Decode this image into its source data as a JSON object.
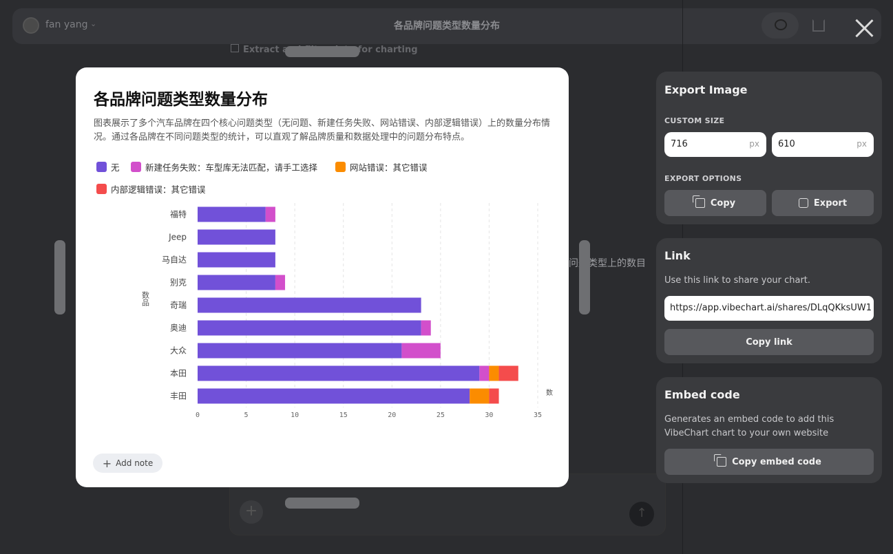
{
  "background": {
    "user_name": "fan yang",
    "chart_title": "各品牌问题类型数量分布",
    "step_label": "Extract and filter data for charting",
    "partial_text": "问题类型上的数目"
  },
  "modal": {
    "title": "各品牌问题类型数量分布",
    "description": "图表展示了多个汽车品牌在四个核心问题类型（无问题、新建任务失败、网站错误、内部逻辑错误）上的数量分布情况。通过各品牌在不同问题类型的统计，可以直观了解品牌质量和数据处理中的问题分布特点。",
    "add_note_label": "Add note"
  },
  "chart_data": {
    "type": "bar",
    "orientation": "horizontal",
    "stacked": true,
    "categories": [
      "福特",
      "Jeep",
      "马自达",
      "别克",
      "奇瑞",
      "奥迪",
      "大众",
      "本田",
      "丰田"
    ],
    "series": [
      {
        "name": "无",
        "color": "#7151d9",
        "values": [
          7,
          8,
          8,
          8,
          23,
          23,
          21,
          29,
          28
        ]
      },
      {
        "name": "新建任务失败：车型库无法匹配，请手工选择",
        "color": "#d24fcb",
        "values": [
          1,
          0,
          0,
          1,
          0,
          1,
          4,
          1,
          0
        ]
      },
      {
        "name": "网站错误：其它错误",
        "color": "#fb8c00",
        "values": [
          0,
          0,
          0,
          0,
          0,
          0,
          0,
          1,
          2
        ]
      },
      {
        "name": "内部逻辑错误：其它错误",
        "color": "#f44c4c",
        "values": [
          0,
          0,
          0,
          0,
          0,
          0,
          0,
          2,
          1
        ]
      }
    ],
    "xticks": [
      "0",
      "5",
      "10",
      "15",
      "20",
      "25",
      "30",
      "35"
    ],
    "xlim": [
      0,
      35
    ],
    "xlabel": "数",
    "ylabel": "数品",
    "grid": true,
    "legend_position": "top"
  },
  "export_panel": {
    "title": "Export Image",
    "custom_size_label": "CUSTOM SIZE",
    "width_value": "716",
    "height_value": "610",
    "unit": "px",
    "export_options_label": "EXPORT OPTIONS",
    "copy_label": "Copy",
    "export_label": "Export"
  },
  "link_panel": {
    "title": "Link",
    "description": "Use this link to share your chart.",
    "url": "https://app.vibechart.ai/shares/DLqQKksUW1",
    "copy_link_label": "Copy link"
  },
  "embed_panel": {
    "title": "Embed code",
    "description": "Generates an embed code to add this VibeChart chart to your own website",
    "copy_embed_label": "Copy embed code"
  }
}
